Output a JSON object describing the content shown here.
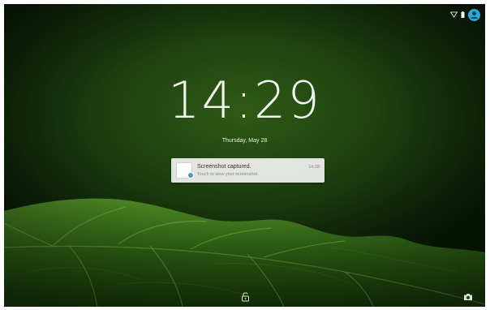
{
  "lockscreen": {
    "time": "14:29",
    "date": "Thursday, May 28"
  },
  "notification": {
    "title": "Screenshot captured.",
    "subtitle": "Touch to view your screenshot.",
    "time": "14:28"
  },
  "status_bar": {
    "icons": [
      "wifi-icon",
      "battery-icon",
      "user-avatar-icon"
    ]
  },
  "shortcuts": {
    "icons": [
      "unlock-icon",
      "camera-icon"
    ]
  },
  "colors": {
    "accent": "#29a9d8",
    "wallpaper_dark": "#132d0a",
    "wallpaper_light": "#2f5a14",
    "notification_bg": "#f0f0f0"
  }
}
